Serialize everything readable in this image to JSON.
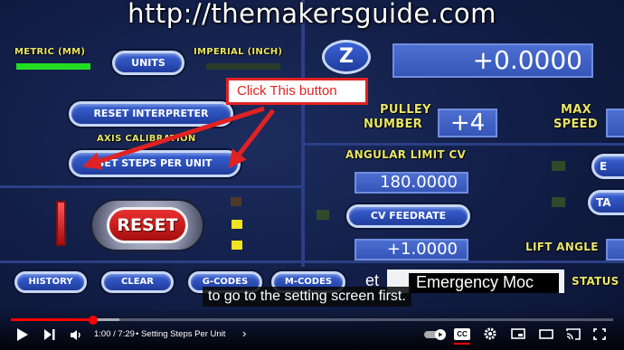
{
  "video": {
    "watermark": "http://themakersguide.com",
    "caption": "to go to the setting screen first.",
    "annotation": "Click This button"
  },
  "cnc": {
    "metric_label": "METRIC (MM)",
    "imperial_label": "IMPERIAL (INCH)",
    "units_button": "UNITS",
    "reset_interpreter_button": "RESET INTERPRETER",
    "axis_calibration_label": "AXIS CALIBRATION",
    "set_steps_button": "SET STEPS PER UNIT",
    "reset_button": "RESET",
    "z_button": "Z",
    "z_dro": "+0.0000",
    "pulley_label_1": "PULLEY",
    "pulley_label_2": "NUMBER",
    "pulley_value": "+4",
    "max_speed_1": "MAX",
    "max_speed_2": "SPEED",
    "angular_limit_label": "ANGULAR LIMIT CV",
    "angular_limit_value": "180.0000",
    "cv_feedrate_button": "CV FEEDRATE",
    "cv_feedrate_value": "+1.0000",
    "lift_angle_label": "LIFT ANGLE",
    "right_btn_1": "E",
    "right_btn_2": "TA",
    "history_button": "HISTORY",
    "clear_button": "CLEAR",
    "gcodes_button": "G-CODES",
    "mcodes_button": "M-CODES",
    "status_prefix": "et",
    "status_text": "Emergency Moc",
    "status_label": "STATUS"
  },
  "player": {
    "time": "1:00 / 7:29",
    "chapter": "• Setting Steps Per Unit",
    "chapter_chevron": "›",
    "progress": 0.134,
    "icons": [
      "play-icon",
      "next-icon",
      "volume-icon",
      "autoplay-icon",
      "cc-icon",
      "settings-icon",
      "miniplayer-icon",
      "theater-icon",
      "cast-icon",
      "fullscreen-icon"
    ],
    "cc_label": "CC"
  },
  "colors": {
    "panel_label": "#e8e66a",
    "led_green": "#22dd22",
    "led_yellow": "#f4e41c",
    "reset_red": "#c81818",
    "annotation_red": "#e02222",
    "progress_red": "#ff0000"
  }
}
